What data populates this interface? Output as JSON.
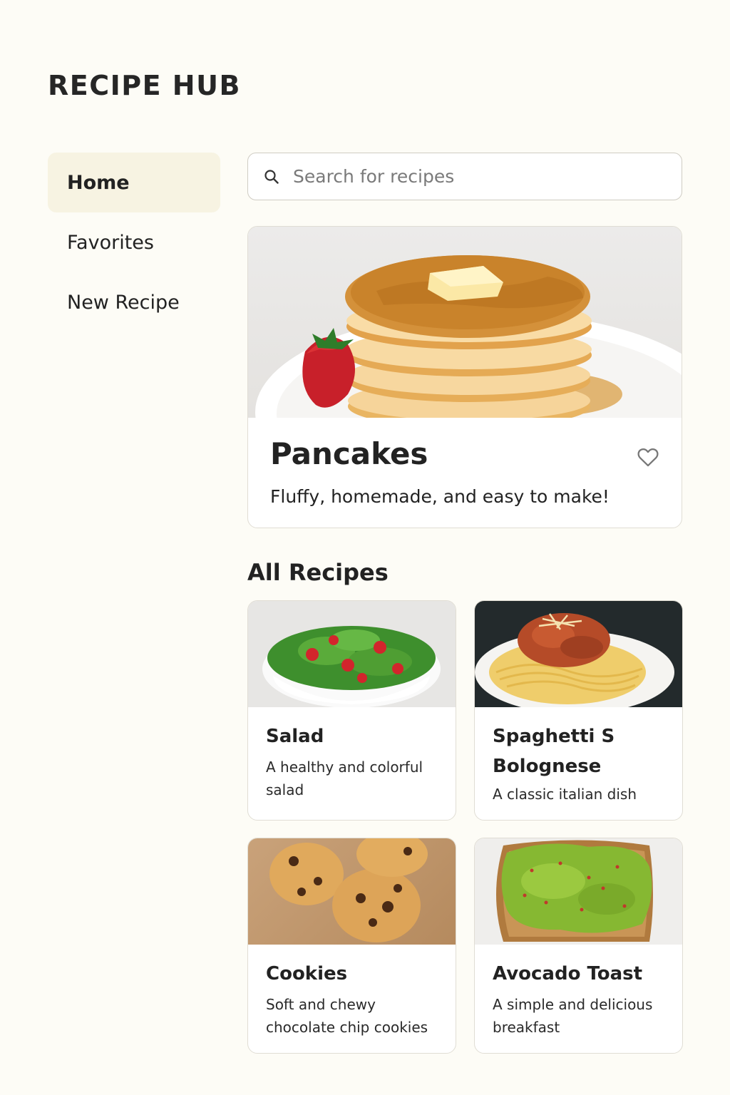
{
  "app": {
    "title": "RECIPE HUB"
  },
  "sidebar": {
    "items": [
      {
        "label": "Home",
        "active": true
      },
      {
        "label": "Favorites",
        "active": false
      },
      {
        "label": "New Recipe",
        "active": false
      }
    ]
  },
  "search": {
    "placeholder": "Search for recipes",
    "value": "",
    "icon": "search-icon"
  },
  "featured": {
    "title": "Pancakes",
    "description": "Fluffy, homemade, and easy to make!",
    "favorite_icon": "heart-outline-icon",
    "image": "pancake-stack-photo"
  },
  "all_recipes": {
    "heading": "All Recipes",
    "items": [
      {
        "name": "Salad",
        "description": "A healthy and colorful salad",
        "image": "salad-bowl-photo"
      },
      {
        "name": "Spaghetti S Bolognese",
        "description": "A classic italian dish",
        "image": "spaghetti-plate-photo"
      },
      {
        "name": "Cookies",
        "description": "Soft and chewy chocolate chip cookies",
        "image": "cookies-photo"
      },
      {
        "name": "Avocado Toast",
        "description": "A simple and delicious breakfast",
        "image": "avocado-toast-photo"
      }
    ]
  },
  "colors": {
    "background": "#fdfcf6",
    "active_nav": "#f7f3e2",
    "card_border": "#e0ddd4",
    "text": "#222222"
  }
}
